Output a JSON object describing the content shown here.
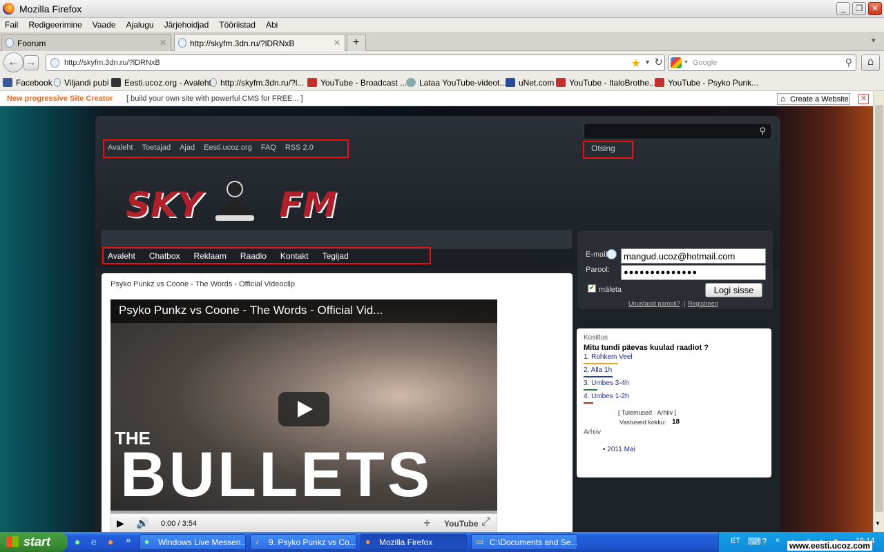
{
  "window": {
    "title": "Mozilla Firefox"
  },
  "menu": [
    "Fail",
    "Redigeerimine",
    "Vaade",
    "Ajalugu",
    "Järjehoidjad",
    "Tööriistad",
    "Abi"
  ],
  "tabs": [
    {
      "label": "Foorum"
    },
    {
      "label": "http://skyfm.3dn.ru/?lDRNxB"
    }
  ],
  "nav": {
    "url": "http://skyfm.3dn.ru/?lDRNxB",
    "search_placeholder": "Google"
  },
  "bookmarks": [
    "Facebook",
    "Viljandi pubi",
    "Eesti.ucoz.org - Avaleht",
    "http://skyfm.3dn.ru/?l...",
    "YouTube - Broadcast ...",
    "Lataa YouTube-videot...",
    "uNet.com",
    "YouTube - ItaloBrothe...",
    "YouTube - Psyko Punk..."
  ],
  "ucoz": {
    "promo": "New progressive Site Creator",
    "tagline": "[ build your own site with powerful CMS for FREE... ]",
    "create": "Create a Website"
  },
  "site": {
    "top_nav": [
      "Avaleht",
      "Toetajad",
      "Ajad",
      "Eesti.ucoz.org",
      "FAQ",
      "RSS 2.0"
    ],
    "search_label": "Otsing",
    "logo_left": "SKY",
    "logo_right": "FM",
    "main_nav": [
      "Avaleht",
      "Chatbox",
      "Reklaam",
      "Raadio",
      "Kontakt",
      "Tegijad"
    ],
    "content_title": "Psyko Punkz vs Coone - The Words - Official Videoclip",
    "video": {
      "title": "Psyko Punkz vs Coone - The Words - Official Vid...",
      "overlay_small": "THE",
      "overlay_big": "BULLETS",
      "time": "0:00 / 3:54",
      "brand": "YouTube"
    },
    "login": {
      "email_label": "E-mail:",
      "email_value": "mangud.ucoz@hotmail.com",
      "password_label": "Parool:",
      "password_value": "●●●●●●●●●●●●●●",
      "remember": "mäleta",
      "submit": "Logi sisse",
      "forgot": "Unustasid parooli?",
      "separator": "|",
      "register": "Registreeri"
    },
    "poll": {
      "heading": "Küsitlus",
      "question": "Mitu tundi päevas kuulad raadiot ?",
      "options": [
        {
          "label": "1. Rohkem Veel",
          "color": "#e8a020"
        },
        {
          "label": "2. Alla 1h",
          "color": "#2040a0"
        },
        {
          "label": "3. Umbes 3-4h",
          "color": "#208040"
        },
        {
          "label": "4. Umbes 1-2h",
          "color": "#b03020"
        }
      ],
      "links": "[ Tulemused · Arhiiv ]",
      "total_label": "Vastuseid kokku:",
      "total": "18",
      "archive_heading": "Arhiiv",
      "archive_item": "2011 Mai"
    }
  },
  "taskbar": {
    "start": "start",
    "buttons": [
      "Windows Live Messen...",
      "9. Psyko Punkz vs Co...",
      "Mozilla Firefox",
      "C:\\Documents and Se..."
    ],
    "lang": "ET",
    "clock": "15:14",
    "watermark": "www.eesti.ucoz.com"
  }
}
